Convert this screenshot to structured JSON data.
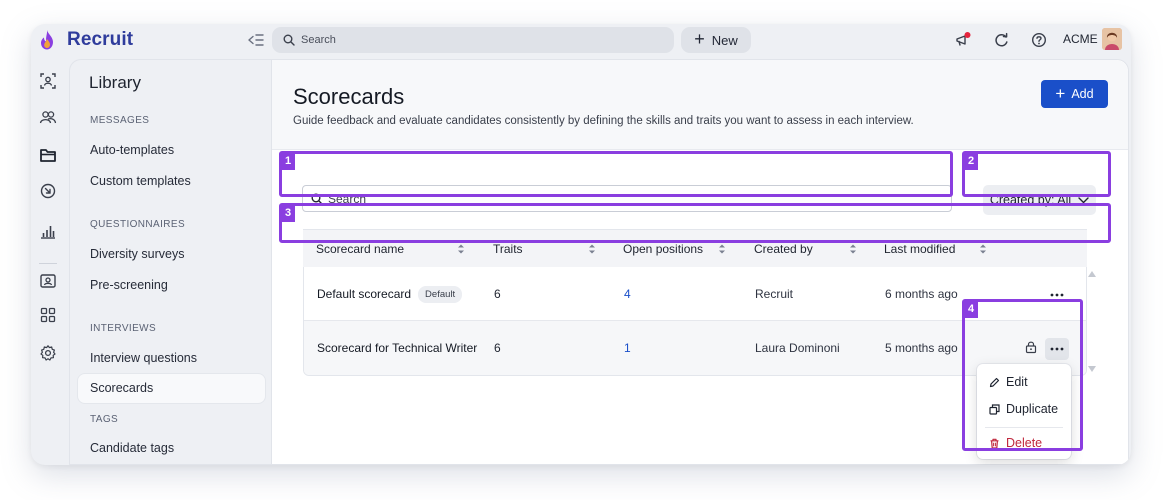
{
  "app": {
    "brand": "Recruit",
    "workspace": "ACME"
  },
  "topbar": {
    "search_placeholder": "Search",
    "new_label": "New"
  },
  "library": {
    "title": "Library",
    "sections": [
      {
        "heading": "MESSAGES",
        "items": [
          "Auto-templates",
          "Custom templates"
        ]
      },
      {
        "heading": "QUESTIONNAIRES",
        "items": [
          "Diversity surveys",
          "Pre-screening"
        ]
      },
      {
        "heading": "INTERVIEWS",
        "items": [
          "Interview questions",
          "Scorecards"
        ]
      },
      {
        "heading": "TAGS",
        "items": [
          "Candidate tags"
        ]
      }
    ],
    "active_item": "Scorecards"
  },
  "page": {
    "title": "Scorecards",
    "subtitle": "Guide feedback and evaluate candidates consistently by defining the skills and traits you want to assess in each interview.",
    "add_label": "Add"
  },
  "toolbar": {
    "search_placeholder": "Search",
    "filter_label": "Created by: All"
  },
  "table": {
    "columns": [
      "Scorecard name",
      "Traits",
      "Open positions",
      "Created by",
      "Last modified"
    ],
    "rows": [
      {
        "name": "Default scorecard",
        "badge": "Default",
        "traits": "6",
        "open_positions": "4",
        "created_by": "Recruit",
        "last_modified": "6 months ago"
      },
      {
        "name": "Scorecard for Technical Writer",
        "badge": "",
        "traits": "6",
        "open_positions": "1",
        "created_by": "Laura Dominoni",
        "last_modified": "5 months ago"
      }
    ]
  },
  "row_menu": {
    "items": [
      "Edit",
      "Duplicate",
      "Delete"
    ]
  },
  "annotations": [
    "1",
    "2",
    "3",
    "4"
  ],
  "colors": {
    "brand": "#2f3c9c",
    "accent": "#1a4fc9",
    "annotation": "#8a3ee0",
    "danger": "#c0273d",
    "notification": "#e5233c"
  }
}
